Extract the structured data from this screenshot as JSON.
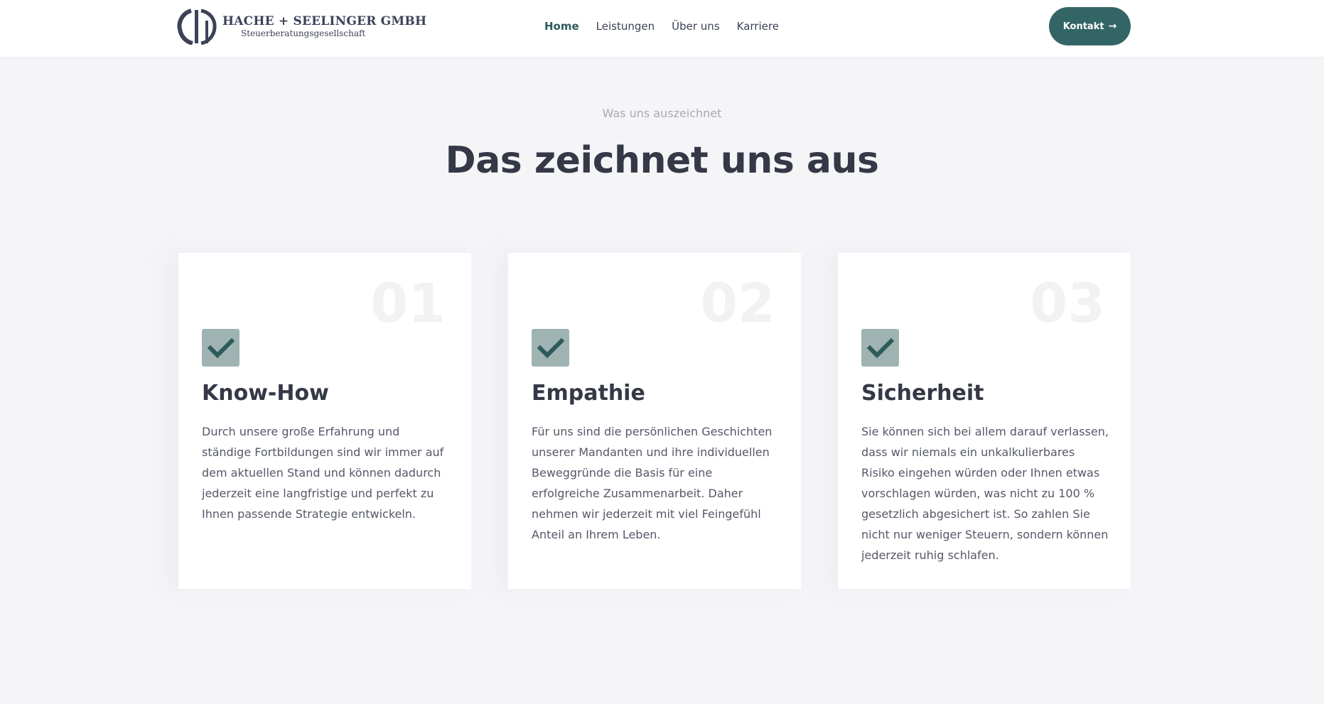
{
  "header": {
    "logo_title": "HACHE + SEELINGER GMBH",
    "logo_subtitle": "Steuerberatungsgesellschaft",
    "nav": [
      {
        "label": "Home",
        "active": true
      },
      {
        "label": "Leistungen",
        "active": false
      },
      {
        "label": "Über uns",
        "active": false
      },
      {
        "label": "Karriere",
        "active": false
      }
    ],
    "cta_label": "Kontakt",
    "cta_icon": "arrow-right-icon"
  },
  "section": {
    "eyebrow": "Was uns auszeichnet",
    "title": "Das zeichnet uns aus"
  },
  "cards": [
    {
      "number": "01",
      "icon": "check-icon",
      "title": "Know-How",
      "text": "Durch unsere große Erfahrung und ständige Fortbildungen sind wir immer auf dem aktuellen Stand und können dadurch jederzeit eine langfristige und perfekt zu Ihnen passende Strategie entwickeln."
    },
    {
      "number": "02",
      "icon": "check-icon",
      "title": "Empathie",
      "text": "Für uns sind die persönlichen Geschichten unserer Mandanten und ihre individuellen Beweggründe die Basis für eine erfolgreiche Zusammenarbeit. Daher nehmen wir jederzeit mit viel Feingefühl Anteil an Ihrem Leben."
    },
    {
      "number": "03",
      "icon": "check-icon",
      "title": "Sicherheit",
      "text": "Sie können sich bei allem darauf verlassen, dass wir niemals ein unkalkulierbares Risiko eingehen würden oder Ihnen etwas vorschlagen würden, was nicht zu 100 % gesetzlich abgesichert ist. So zahlen Sie nicht nur weniger Steuern, sondern können jederzeit ruhig schlafen."
    }
  ],
  "colors": {
    "brand_dark": "#346566",
    "check_bg": "#9fb4b2",
    "check_mark": "#2f5a5b",
    "page_bg": "#f5f5f8"
  }
}
